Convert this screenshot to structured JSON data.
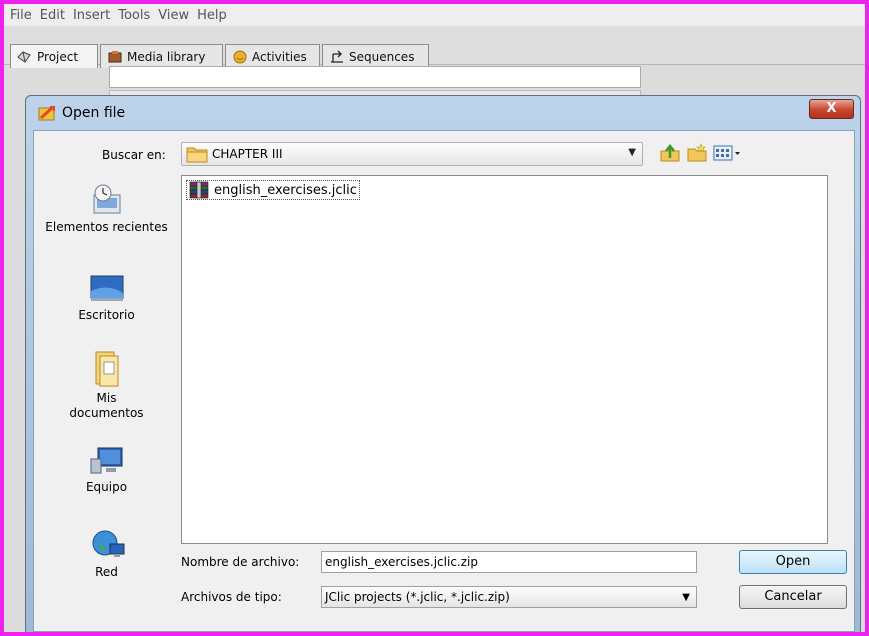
{
  "menubar": [
    "File",
    "Edit",
    "Insert",
    "Tools",
    "View",
    "Help"
  ],
  "tabs": [
    {
      "label": "Project",
      "icon": "project-icon"
    },
    {
      "label": "Media library",
      "icon": "media-library-icon"
    },
    {
      "label": "Activities",
      "icon": "activities-icon"
    },
    {
      "label": "Sequences",
      "icon": "sequences-icon"
    }
  ],
  "dialog": {
    "title": "Open file",
    "close_label": "X",
    "look_in_label": "Buscar en:",
    "look_in_value": "CHAPTER III",
    "places": [
      {
        "label": "Elementos recientes",
        "icon": "recent-items-icon"
      },
      {
        "label": "Escritorio",
        "icon": "desktop-icon"
      },
      {
        "label": "Mis documentos",
        "icon": "documents-icon"
      },
      {
        "label": "Equipo",
        "icon": "computer-icon"
      },
      {
        "label": "Red",
        "icon": "network-icon"
      }
    ],
    "files": [
      {
        "name": "english_exercises.jclic",
        "icon": "archive-file-icon"
      }
    ],
    "file_name_label": "Nombre de archivo:",
    "file_name_value": "english_exercises.jclic.zip",
    "file_type_label": "Archivos de tipo:",
    "file_type_value": "JClic projects (*.jclic, *.jclic.zip)",
    "open_label": "Open",
    "cancel_label": "Cancelar"
  },
  "colors": {
    "outer_border": "#ee22ee",
    "dialog_frame": "#9eb9d6",
    "close_button": "#c8452f",
    "default_button": "#bde1f6"
  }
}
